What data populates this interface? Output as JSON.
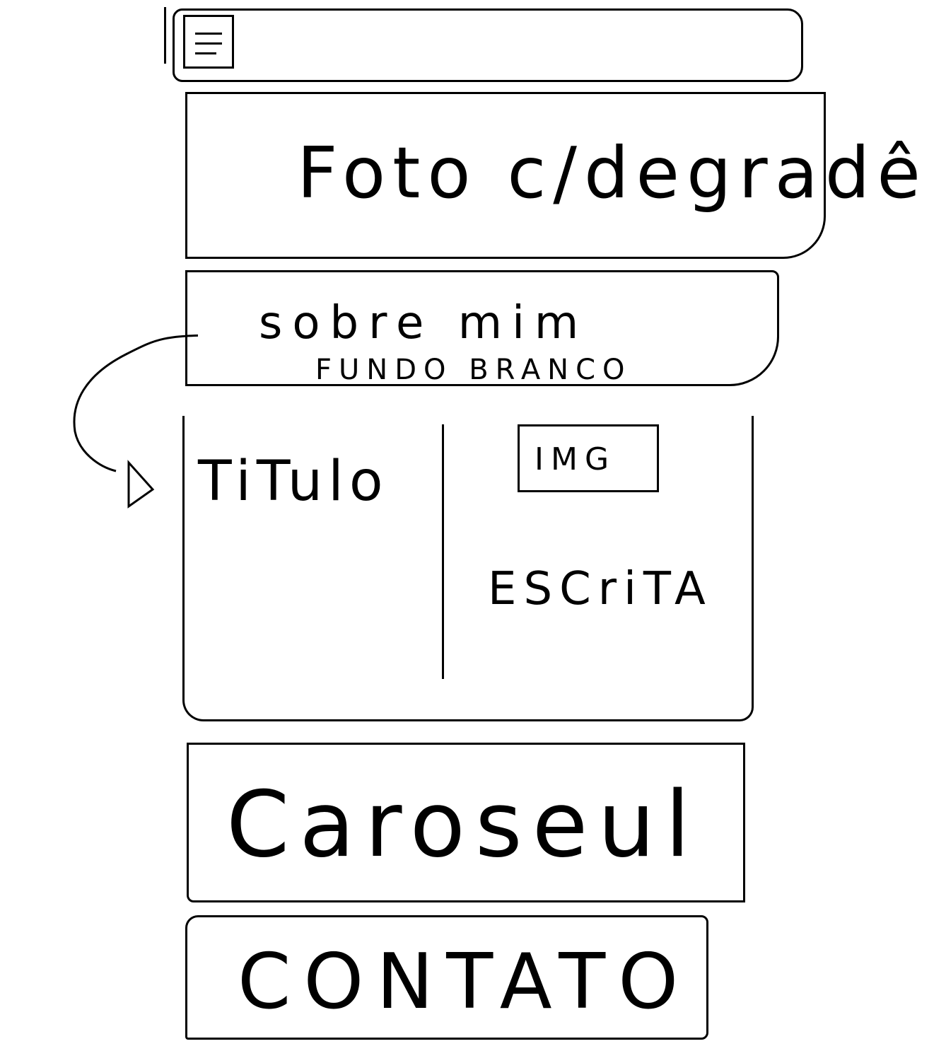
{
  "navbar": {
    "menu_icon": "hamburger-menu-icon"
  },
  "hero": {
    "label": "Foto c/degradê"
  },
  "about": {
    "title": "sobre mim",
    "subtitle": "FUNDO BRANCO"
  },
  "content": {
    "title": "TiTulo",
    "image_label": "IMG",
    "text": "ESCriTA"
  },
  "carousel": {
    "label": "Caroseul"
  },
  "contact": {
    "label": "CONTATO"
  }
}
